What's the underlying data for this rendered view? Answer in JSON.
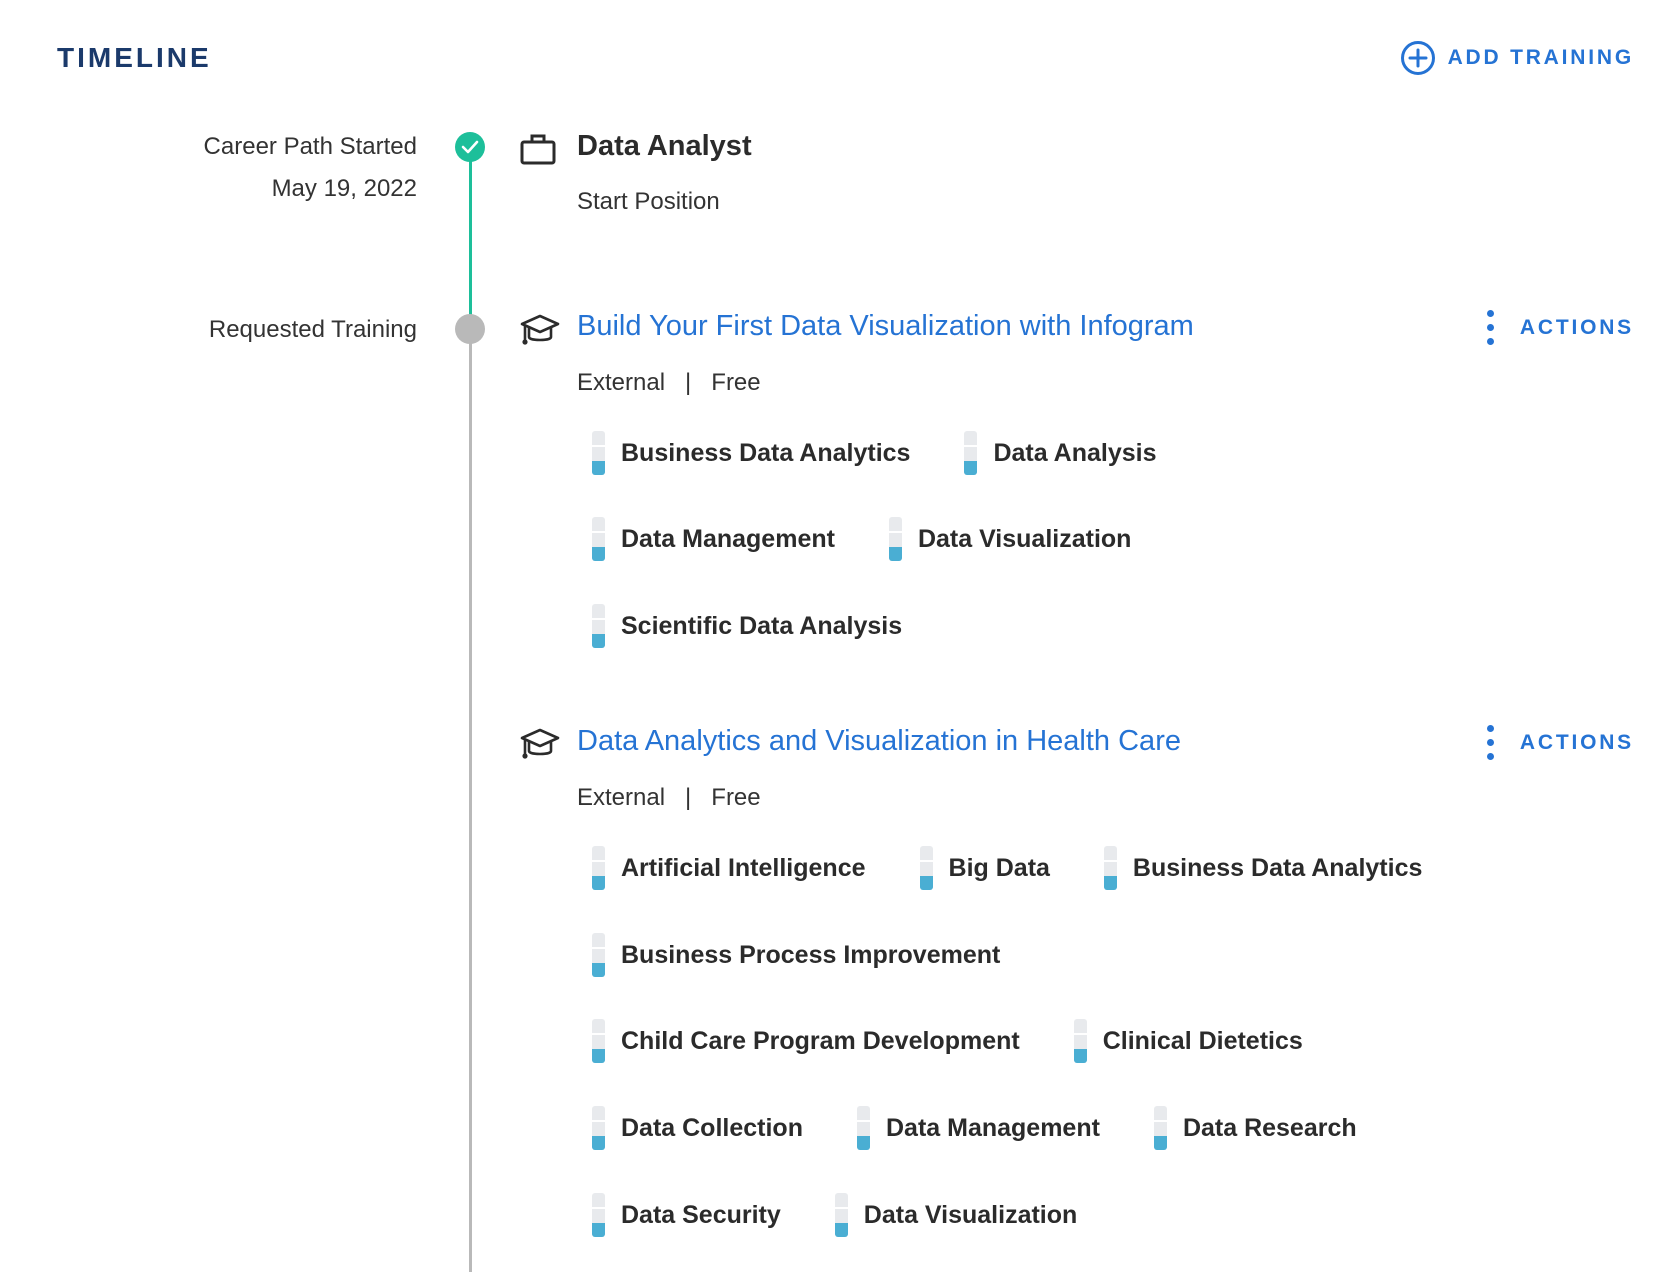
{
  "header": {
    "title": "TIMELINE",
    "add_training_label": "ADD TRAINING",
    "accent_color": "#2573d4"
  },
  "start": {
    "label_line1": "Career Path Started",
    "label_line2": "May 19, 2022",
    "title": "Data Analyst",
    "subtitle": "Start Position",
    "icon": "briefcase-icon",
    "status_color": "#1dbf9a"
  },
  "requested": {
    "label": "Requested Training",
    "status_color": "#b9b9b9"
  },
  "trainings": [
    {
      "title": "Build Your First Data Visualization with Infogram",
      "source": "External",
      "separator": "|",
      "cost": "Free",
      "actions_label": "ACTIONS",
      "icon": "graduation-cap-icon",
      "skill_rows": [
        [
          "Business Data Analytics",
          "Data Analysis"
        ],
        [
          "Data Management",
          "Data Visualization"
        ],
        [
          "Scientific Data Analysis"
        ]
      ]
    },
    {
      "title": "Data Analytics and Visualization in Health Care",
      "source": "External",
      "separator": "|",
      "cost": "Free",
      "actions_label": "ACTIONS",
      "icon": "graduation-cap-icon",
      "skill_rows": [
        [
          "Artificial Intelligence",
          "Big Data",
          "Business Data Analytics"
        ],
        [
          "Business Process Improvement"
        ],
        [
          "Child Care Program Development",
          "Clinical Dietetics"
        ],
        [
          "Data Collection",
          "Data Management",
          "Data Research"
        ],
        [
          "Data Security",
          "Data Visualization"
        ]
      ]
    }
  ]
}
